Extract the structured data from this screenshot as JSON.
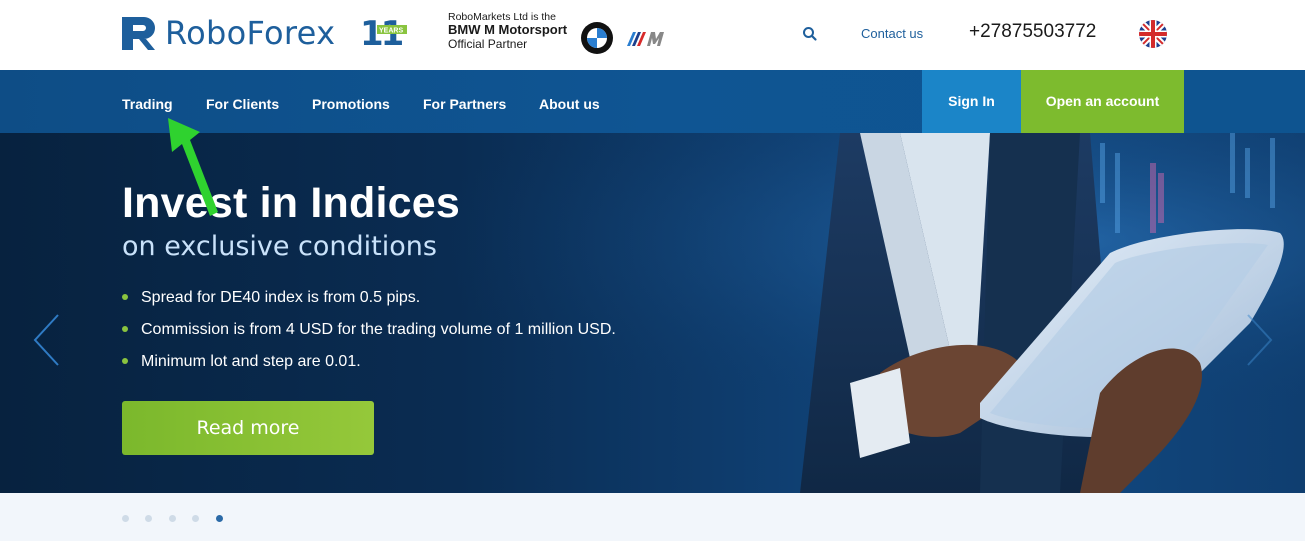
{
  "header": {
    "logo_text": "RoboForex",
    "years_badge": {
      "number": "11",
      "label": "YEARS"
    },
    "partner_line1": "RoboMarkets Ltd is the",
    "partner_line2": "BMW M Motorsport",
    "partner_line3": "Official Partner",
    "contact_label": "Contact us",
    "phone": "+27875503772",
    "icons": {
      "search": "search-icon",
      "flag": "uk-flag-icon",
      "bmw": "bmw-logo",
      "m": "m-motorsport-logo"
    }
  },
  "nav": {
    "items": [
      {
        "label": "Trading"
      },
      {
        "label": "For Clients"
      },
      {
        "label": "Promotions"
      },
      {
        "label": "For Partners"
      },
      {
        "label": "About us"
      }
    ],
    "sign_in": "Sign In",
    "open_account": "Open an account"
  },
  "hero": {
    "title": "Invest in Indices",
    "subtitle": "on exclusive conditions",
    "bullets": [
      "Spread for DE40 index is from 0.5 pips.",
      "Commission is from 4 USD for the trading volume of 1 million USD.",
      "Minimum lot and step are 0.01."
    ],
    "cta": "Read more"
  },
  "carousel": {
    "slide_count": 5,
    "active_index": 4
  },
  "colors": {
    "brand_blue": "#1e5f9c",
    "nav_blue": "#0f5593",
    "signin_blue": "#1b85c8",
    "accent_green": "#7dbb2e",
    "annotation_green": "#2fd22f"
  }
}
